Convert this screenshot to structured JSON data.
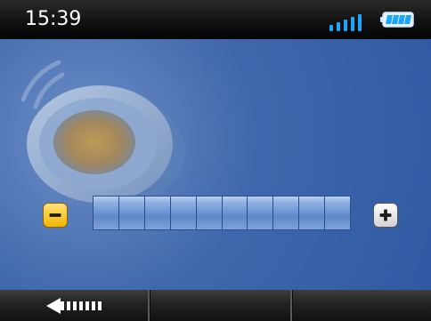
{
  "status_bar": {
    "time": "15:39",
    "signal_icon": "signal-strength-icon",
    "battery_icon": "battery-icon",
    "accent_color": "#1aa6ff"
  },
  "volume": {
    "level_fraction": 1.0,
    "segments": 10,
    "minus_icon": "minus-icon",
    "plus_icon": "plus-icon",
    "speaker_icon": "speaker-icon"
  },
  "bottom_bar": {
    "back_icon": "back-arrow-icon"
  }
}
